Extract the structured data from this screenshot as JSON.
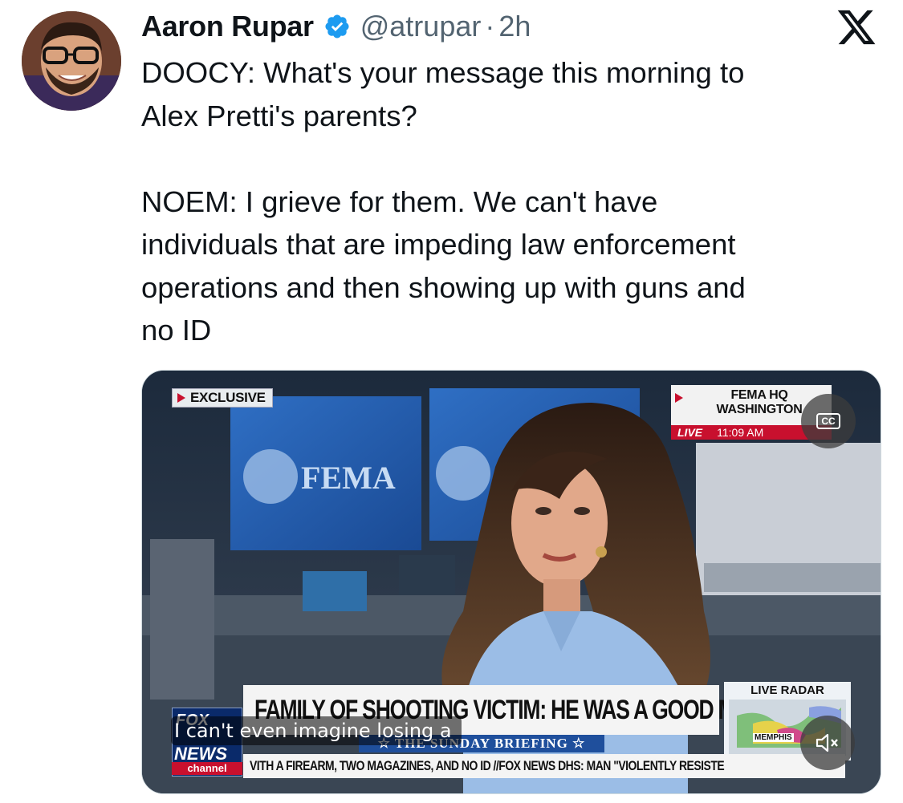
{
  "author": {
    "display_name": "Aaron Rupar",
    "handle": "@atrupar",
    "separator": "·",
    "time": "2h",
    "avatar_icon": "avatar-photo",
    "verified_icon": "verified-badge-icon",
    "verified_color": "#1d9bf0"
  },
  "platform_icon": "x-logo-icon",
  "tweet": {
    "lines": [
      "DOOCY: What's your message this morning to",
      "Alex Pretti's parents?",
      "NOEM: I grieve for them. We can't have",
      "individuals that are impeding law enforcement",
      "operations and then showing up with guns and",
      "no ID"
    ]
  },
  "video": {
    "background_signs": [
      "FEMA"
    ],
    "exclusive_label": "EXCLUSIVE",
    "location_line1": "FEMA HQ",
    "location_line2": "WASHINGTON",
    "live_label": "LIVE",
    "live_time": "11:09 AM",
    "cc_label": "CC",
    "network_logo_text": "NEWS",
    "network_logo_top": "FOX",
    "network_channel": "channel",
    "headline": "FAMILY OF SHOOTING VICTIM: HE WAS A GOOD MAN",
    "show_name": "☆ THE SUNDAY BRIEFING ☆",
    "radar_title": "LIVE RADAR",
    "radar_city": "MEMPHIS",
    "ticker": "VITH A FIREARM, TWO MAGAZINES, AND NO ID   //FOX NEWS   DHS: MAN \"VIOLENTLY RESISTE",
    "caption": "I can't even imagine losing a",
    "mute_icon": "speaker-muted-icon",
    "accent_red": "#c8102e",
    "accent_blue": "#1f4f9c"
  }
}
